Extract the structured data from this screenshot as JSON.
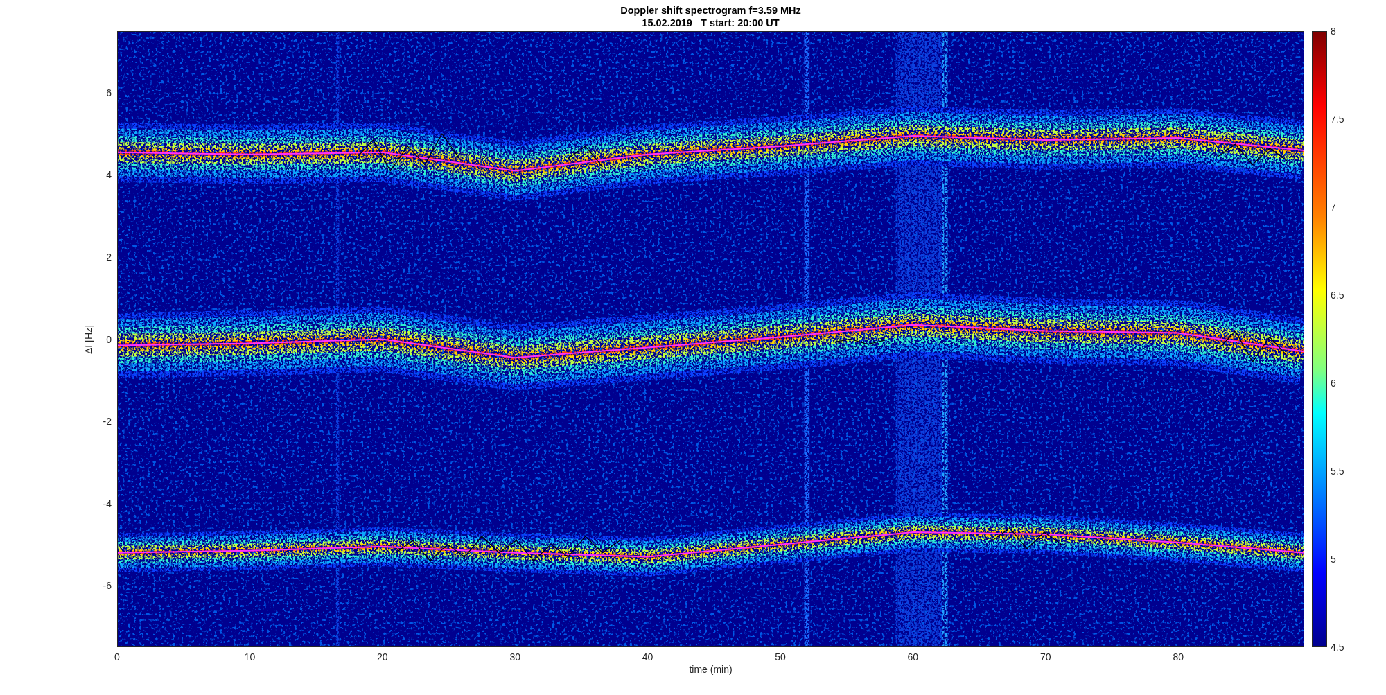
{
  "title": {
    "lines": [
      "Doppler shift spectrogram f=3.59 MHz",
      "15.02.2019   T start: 20:00 UT"
    ]
  },
  "y_axis": {
    "label": "Δf [Hz]",
    "ticks": [
      "6",
      "4",
      "2",
      "0",
      "-2",
      "-4",
      "-6"
    ]
  },
  "x_axis": {
    "label": "time (min)",
    "ticks": [
      "0",
      "10",
      "20",
      "30",
      "40",
      "50",
      "60",
      "70",
      "80"
    ]
  },
  "colorbar": {
    "ticks": [
      "8",
      "7.5",
      "7",
      "6.5",
      "6",
      "5.5",
      "5",
      "4.5"
    ]
  }
}
